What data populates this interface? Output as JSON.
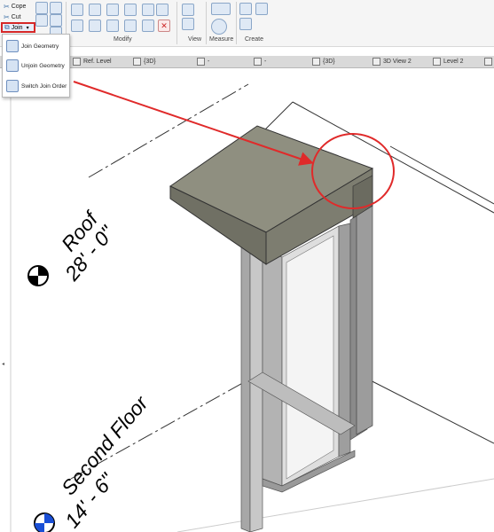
{
  "ribbon": {
    "left_tools": [
      {
        "label": "Cope",
        "icon": "cope-icon"
      },
      {
        "label": "Cut",
        "icon": "cut-icon"
      }
    ],
    "join_label": "Join",
    "panels": {
      "modify": "Modify",
      "view": "View",
      "measure": "Measure",
      "create": "Create"
    }
  },
  "dropdown": {
    "items": [
      {
        "label": "Join Geometry",
        "icon": "join-geometry-icon"
      },
      {
        "label": "Unjoin Geometry",
        "icon": "unjoin-geometry-icon"
      },
      {
        "label": "Switch Join Order",
        "icon": "switch-join-order-icon"
      }
    ]
  },
  "tabs": [
    {
      "label": "Ref. Level"
    },
    {
      "label": "{3D}"
    },
    {
      "label": "-"
    },
    {
      "label": "-"
    },
    {
      "label": "{3D}"
    },
    {
      "label": "3D View 2"
    },
    {
      "label": "Level 2"
    }
  ],
  "levels": [
    {
      "name": "Roof",
      "elevation": "28' - 0\""
    },
    {
      "name": "Second Floor",
      "elevation": "14' - 6\""
    }
  ],
  "colors": {
    "annotation_red": "#e02a2a",
    "slab": "#8c8c7c",
    "frame": "#9c9c9c",
    "ribbon_bg": "#f5f5f5"
  }
}
